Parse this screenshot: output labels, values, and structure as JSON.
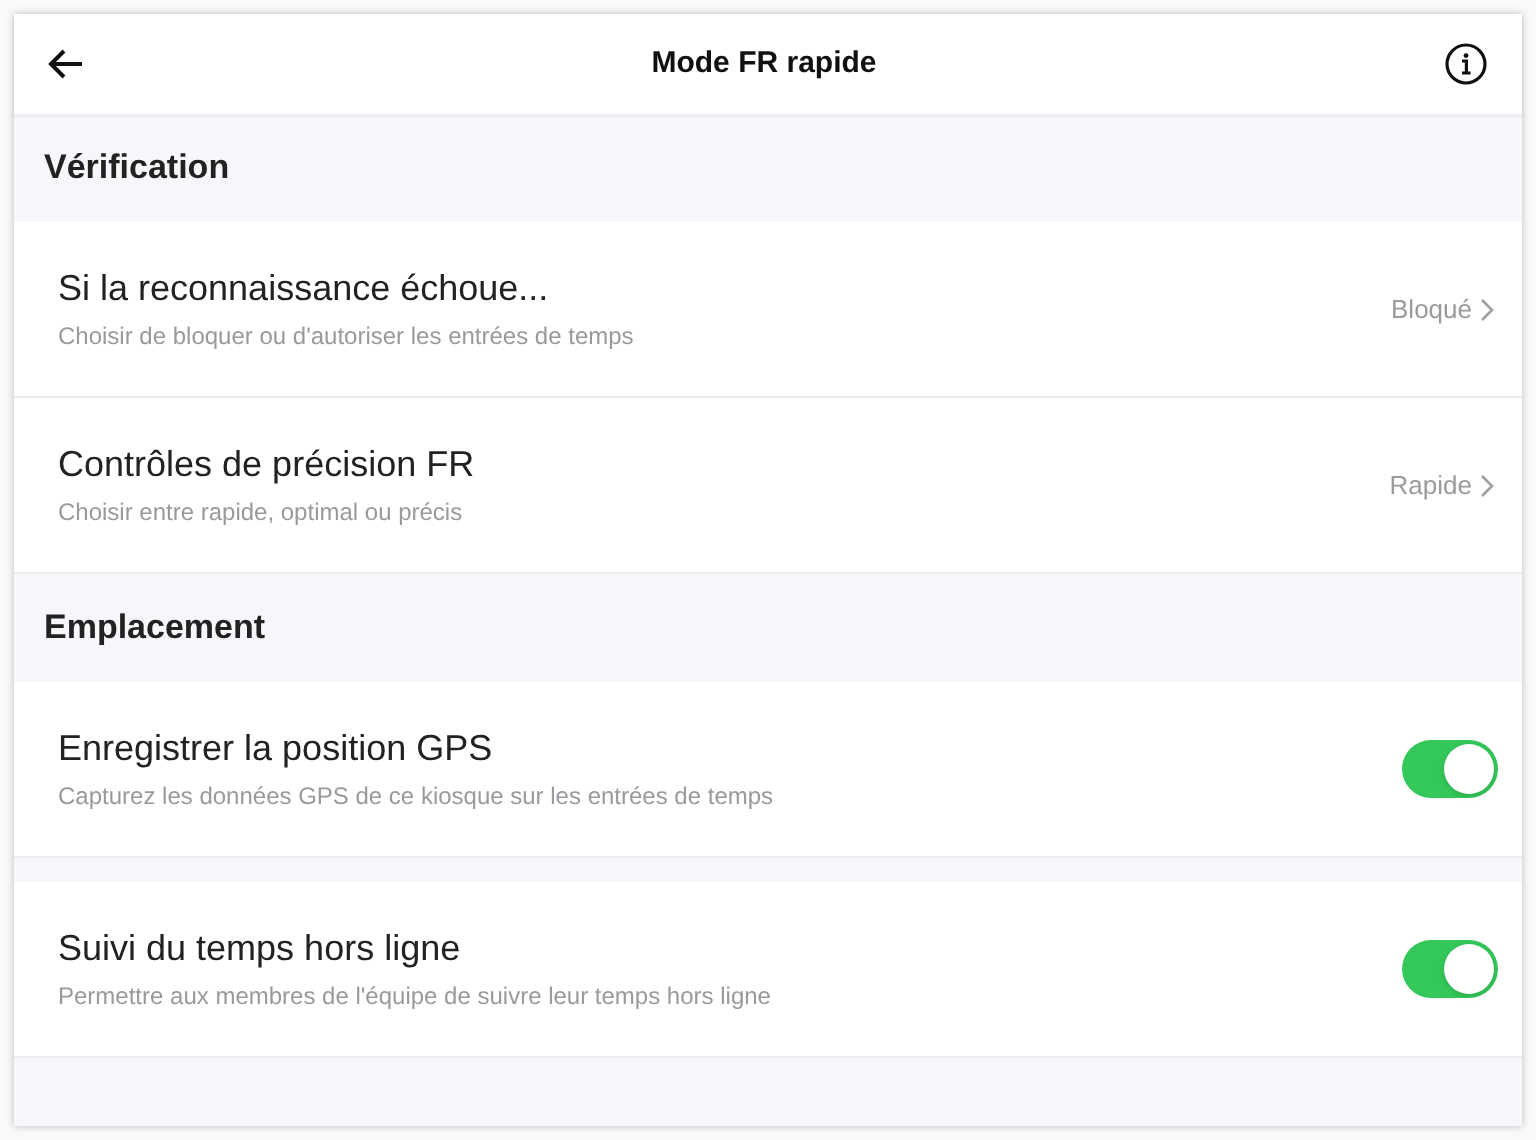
{
  "header": {
    "title": "Mode FR rapide"
  },
  "sections": [
    {
      "title": "Vérification",
      "items": [
        {
          "kind": "link",
          "title": "Si la reconnaissance échoue...",
          "subtitle": "Choisir de bloquer ou d'autoriser les entrées de temps",
          "value": "Bloqué"
        },
        {
          "kind": "link",
          "title": "Contrôles de précision FR",
          "subtitle": "Choisir entre rapide, optimal ou précis",
          "value": "Rapide"
        }
      ]
    },
    {
      "title": "Emplacement",
      "items": [
        {
          "kind": "toggle",
          "title": "Enregistrer la position GPS",
          "subtitle": "Capturez les données GPS de ce kiosque sur les entrées de temps",
          "on": true
        },
        {
          "kind": "toggle",
          "title": "Suivi du temps hors ligne",
          "subtitle": "Permettre aux membres de l'équipe de suivre leur temps hors ligne",
          "on": true
        }
      ]
    }
  ]
}
